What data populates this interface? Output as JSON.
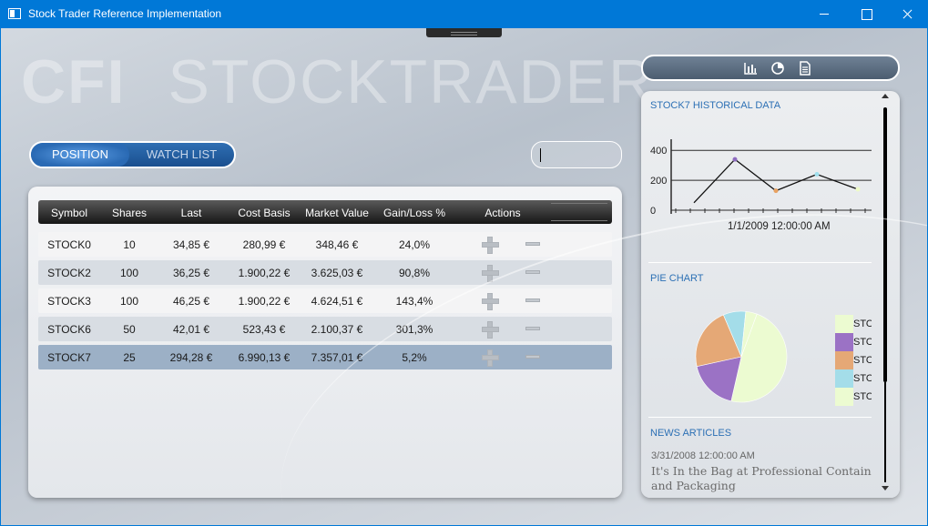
{
  "window": {
    "title": "Stock Trader Reference Implementation"
  },
  "brand": {
    "bold": "CFI",
    "light": "STOCKTRADER"
  },
  "toggle": {
    "position_label": "POSITION",
    "watchlist_label": "WATCH LIST"
  },
  "search": {
    "value": ""
  },
  "positions": {
    "columns": [
      "Symbol",
      "Shares",
      "Last",
      "Cost Basis",
      "Market Value",
      "Gain/Loss %",
      "Actions"
    ],
    "rows": [
      {
        "symbol": "STOCK0",
        "shares": "10",
        "last": "34,85 €",
        "cost_basis": "280,99 €",
        "market_value": "348,46 €",
        "gain_loss": "24,0%"
      },
      {
        "symbol": "STOCK2",
        "shares": "100",
        "last": "36,25 €",
        "cost_basis": "1.900,22 €",
        "market_value": "3.625,03 €",
        "gain_loss": "90,8%"
      },
      {
        "symbol": "STOCK3",
        "shares": "100",
        "last": "46,25 €",
        "cost_basis": "1.900,22 €",
        "market_value": "4.624,51 €",
        "gain_loss": "143,4%"
      },
      {
        "symbol": "STOCK6",
        "shares": "50",
        "last": "42,01 €",
        "cost_basis": "523,43 €",
        "market_value": "2.100,37 €",
        "gain_loss": "301,3%"
      },
      {
        "symbol": "STOCK7",
        "shares": "25",
        "last": "294,28 €",
        "cost_basis": "6.990,13 €",
        "market_value": "7.357,01 €",
        "gain_loss": "5,2%"
      }
    ],
    "selected_symbol": "STOCK7"
  },
  "side_toolbar": {
    "icons": [
      "bar-chart-icon",
      "pie-chart-icon",
      "document-icon"
    ]
  },
  "historical": {
    "title": "STOCK7 HISTORICAL DATA",
    "x_label": "1/1/2009 12:00:00 AM",
    "y_ticks": [
      "400",
      "200",
      "0"
    ]
  },
  "pie": {
    "title": "PIE CHART",
    "legend_label": "STO"
  },
  "news": {
    "title": "NEWS ARTICLES",
    "date": "3/31/2008 12:00:00 AM",
    "headline_line1": "It's In the Bag at Professional Containe",
    "headline_line2": "and Packaging"
  },
  "colors": {
    "titlebar": "#0078d7",
    "accent": "#2c70b5",
    "pie_slices": [
      "#ecfbd1",
      "#9b72c5",
      "#e5a876",
      "#a4dde9",
      "#ecfbd1"
    ]
  },
  "chart_data": [
    {
      "type": "line",
      "title": "STOCK7 HISTORICAL DATA",
      "series": [
        {
          "values": [
            50,
            340,
            130,
            240,
            140
          ],
          "marker_colors": [
            "#8d6bbf",
            "#8d6bbf",
            "#e8a262",
            "#a0e0ee",
            "#eefbc8"
          ]
        }
      ],
      "y_ticks": [
        0,
        200,
        400
      ],
      "ylim": [
        0,
        450
      ],
      "x_tick_label": "1/1/2009 12:00:00 AM",
      "grid": true
    },
    {
      "type": "pie",
      "title": "PIE CHART",
      "slices": [
        {
          "value": 48,
          "color": "#ecfbd1"
        },
        {
          "value": 18,
          "color": "#9b72c5"
        },
        {
          "value": 22,
          "color": "#e5a876"
        },
        {
          "value": 8,
          "color": "#a4dde9"
        },
        {
          "value": 4,
          "color": "#ecfbd1"
        }
      ],
      "legend": [
        "STO",
        "STO",
        "STO",
        "STO",
        "STO"
      ],
      "legend_placement": "right"
    }
  ]
}
